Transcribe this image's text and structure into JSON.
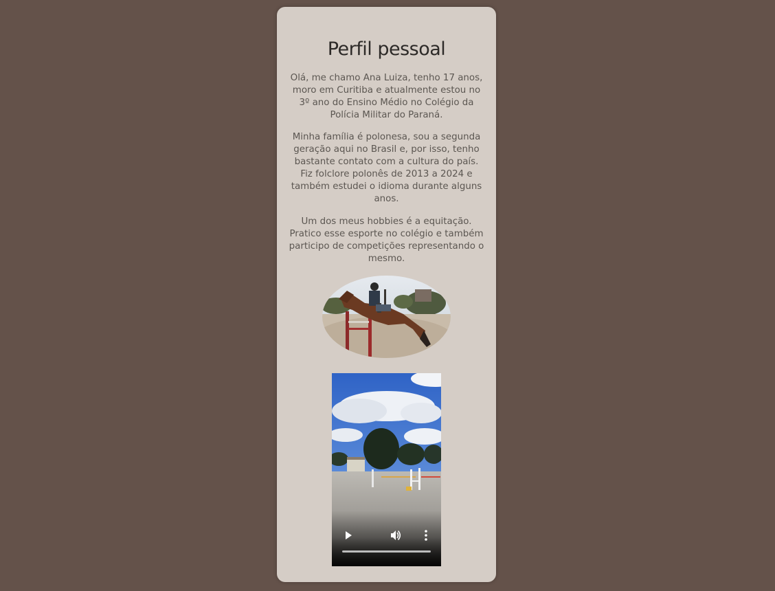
{
  "profile": {
    "title": "Perfil pessoal",
    "paragraphs": [
      "Olá, me chamo Ana Luiza, tenho 17 anos, moro em Curitiba e atualmente estou no 3º ano do Ensino Médio no Colégio da Polícia Militar do Paraná.",
      "Minha família é polonesa, sou a segunda geração aqui no Brasil e, por isso, tenho bastante contato com a cultura do país. Fiz folclore polonês de 2013 a 2024 e também estudei o idioma durante alguns anos.",
      "Um dos meus hobbies é a equitação. Pratico esse esporte no colégio e também participo de competições representando o mesmo."
    ]
  },
  "photo": {
    "subject": "horse-jumping-photo"
  },
  "video": {
    "controls": {
      "play_icon": "play-icon",
      "volume_icon": "volume-icon",
      "more_icon": "more-vertical-icon"
    },
    "progress": 0
  },
  "colors": {
    "background": "#64524a",
    "card": "#d5cdc6",
    "title": "#2d2a28",
    "text": "#5b5651"
  }
}
